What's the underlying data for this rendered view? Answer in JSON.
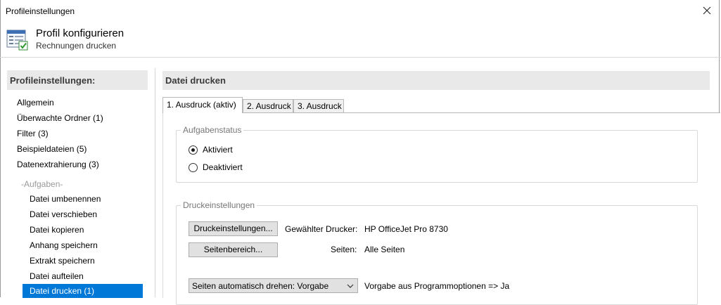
{
  "window": {
    "title": "Profileinstellungen"
  },
  "header": {
    "title": "Profil konfigurieren",
    "subtitle": "Rechnungen drucken"
  },
  "sidebar": {
    "heading": "Profileinstellungen:",
    "items": [
      {
        "label": "Allgemein"
      },
      {
        "label": "Überwachte Ordner (1)"
      },
      {
        "label": "Filter (3)"
      },
      {
        "label": "Beispieldateien (5)"
      },
      {
        "label": "Datenextrahierung (3)"
      }
    ],
    "group_label": "-Aufgaben-",
    "tasks": [
      {
        "label": "Datei umbenennen"
      },
      {
        "label": "Datei verschieben"
      },
      {
        "label": "Datei kopieren"
      },
      {
        "label": "Anhang speichern"
      },
      {
        "label": "Extrakt speichern"
      },
      {
        "label": "Datei aufteilen"
      },
      {
        "label": "Datei drucken (1)",
        "selected": true
      }
    ]
  },
  "main": {
    "heading": "Datei drucken",
    "tabs": [
      {
        "label": "1. Ausdruck (aktiv)",
        "active": true
      },
      {
        "label": "2. Ausdruck"
      },
      {
        "label": "3. Ausdruck"
      }
    ],
    "task_status": {
      "title": "Aufgabenstatus",
      "options": [
        {
          "label": "Aktiviert",
          "checked": true
        },
        {
          "label": "Deaktiviert",
          "checked": false
        }
      ]
    },
    "print_settings": {
      "title": "Druckeinstellungen",
      "print_settings_button": "Druckeinstellungen...",
      "printer_label": "Gewählter Drucker:",
      "printer_value": "HP OfficeJet Pro 8730",
      "page_range_button": "Seitenbereich...",
      "pages_label": "Seiten:",
      "pages_value": "Alle Seiten",
      "rotate_select": "Seiten automatisch drehen: Vorgabe",
      "rotate_note": "Vorgabe aus Programmoptionen => Ja"
    }
  },
  "colors": {
    "selection": "#0078d7",
    "section_bg": "#e9e9e9"
  }
}
